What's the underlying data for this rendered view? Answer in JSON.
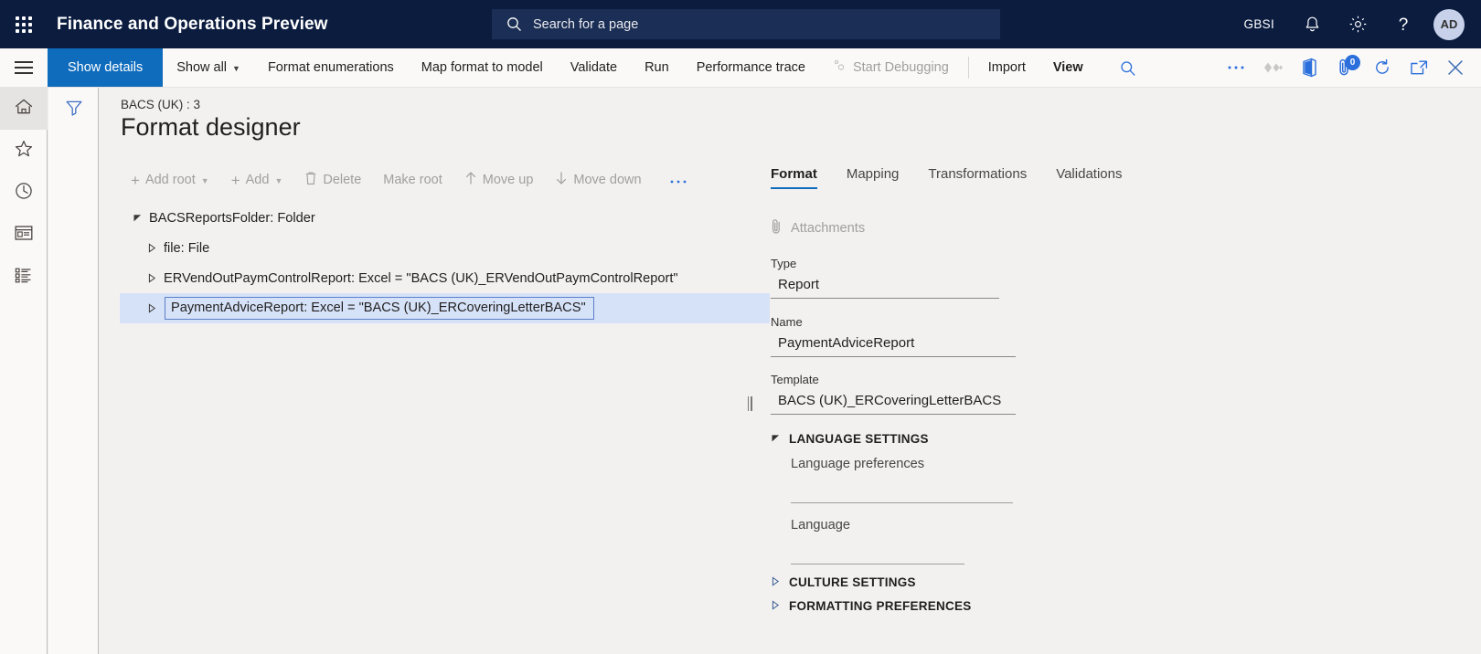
{
  "topbar": {
    "waffle_icon": "app-launcher-icon",
    "app_title": "Finance and Operations Preview",
    "search": {
      "placeholder": "Search for a page",
      "icon": "search-icon"
    },
    "company": "GBSI",
    "notifications_icon": "bell-icon",
    "settings_icon": "gear-icon",
    "help_icon": "question-mark-icon",
    "avatar_initials": "AD"
  },
  "commandbar": {
    "hamburger_icon": "hamburger-menu-icon",
    "buttons": [
      {
        "label": "Show details",
        "style": "primary"
      },
      {
        "label": "Show all",
        "style": "chevron"
      },
      {
        "label": "Format enumerations",
        "style": "plain"
      },
      {
        "label": "Map format to model",
        "style": "plain"
      },
      {
        "label": "Validate",
        "style": "plain"
      },
      {
        "label": "Run",
        "style": "plain"
      },
      {
        "label": "Performance trace",
        "style": "plain"
      },
      {
        "label": "Start Debugging",
        "style": "disabled"
      },
      {
        "label": "Import",
        "style": "plain"
      },
      {
        "label": "View",
        "style": "bold"
      }
    ],
    "right_icons": [
      {
        "name": "search-icon"
      },
      {
        "name": "overflow-ellipsis-icon"
      },
      {
        "name": "personalize-icon"
      },
      {
        "name": "office-app-icon"
      },
      {
        "name": "attachments-icon",
        "badge": "0"
      },
      {
        "name": "refresh-icon"
      },
      {
        "name": "open-in-new-window-icon"
      },
      {
        "name": "close-icon"
      }
    ]
  },
  "rail": {
    "items": [
      {
        "name": "home-icon",
        "active": true
      },
      {
        "name": "favorites-star-icon",
        "active": false
      },
      {
        "name": "recent-clock-icon",
        "active": false
      },
      {
        "name": "workspaces-icon",
        "active": false
      },
      {
        "name": "modules-list-icon",
        "active": false
      }
    ]
  },
  "filter_pane": {
    "icon": "filter-funnel-icon"
  },
  "page": {
    "breadcrumb": "BACS (UK) : 3",
    "title": "Format designer"
  },
  "tree_toolbar": [
    {
      "label": "Add root",
      "icon": "plus-icon",
      "chevron": true
    },
    {
      "label": "Add",
      "icon": "plus-icon",
      "chevron": true
    },
    {
      "label": "Delete",
      "icon": "trash-icon",
      "chevron": false
    },
    {
      "label": "Make root",
      "icon": "",
      "chevron": false
    },
    {
      "label": "Move up",
      "icon": "arrow-up-icon",
      "chevron": false
    },
    {
      "label": "Move down",
      "icon": "arrow-down-icon",
      "chevron": false
    },
    {
      "label": "···",
      "icon": "",
      "chevron": false
    }
  ],
  "tree": {
    "nodes": [
      {
        "label": "BACSReportsFolder: Folder",
        "indent": 0,
        "expanded": true,
        "selected": false
      },
      {
        "label": "file: File",
        "indent": 1,
        "expanded": false,
        "selected": false
      },
      {
        "label": "ERVendOutPaymControlReport: Excel = \"BACS (UK)_ERVendOutPaymControlReport\"",
        "indent": 1,
        "expanded": false,
        "selected": false
      },
      {
        "label": "PaymentAdviceReport: Excel = \"BACS (UK)_ERCoveringLetterBACS\"",
        "indent": 1,
        "expanded": false,
        "selected": true
      }
    ]
  },
  "properties": {
    "tabs": [
      {
        "label": "Format",
        "active": true
      },
      {
        "label": "Mapping",
        "active": false
      },
      {
        "label": "Transformations",
        "active": false
      },
      {
        "label": "Validations",
        "active": false
      }
    ],
    "attachments_label": "Attachments",
    "attachments_icon": "paperclip-icon",
    "fields": [
      {
        "label": "Type",
        "value": "Report"
      },
      {
        "label": "Name",
        "value": "PaymentAdviceReport"
      },
      {
        "label": "Template",
        "value": "BACS (UK)_ERCoveringLetterBACS"
      }
    ],
    "groups": [
      {
        "label": "LANGUAGE SETTINGS",
        "expanded": true
      },
      {
        "label": "CULTURE SETTINGS",
        "expanded": false
      },
      {
        "label": "FORMATTING PREFERENCES",
        "expanded": false
      }
    ],
    "language_fields": [
      {
        "label": "Language preferences",
        "value": ""
      },
      {
        "label": "Language",
        "value": ""
      }
    ]
  },
  "colors": {
    "brand_dark": "#0b1c3f",
    "accent_blue": "#0f6cbd",
    "selection_blue": "#d6e2f8",
    "page_bg": "#f2f1f0"
  }
}
